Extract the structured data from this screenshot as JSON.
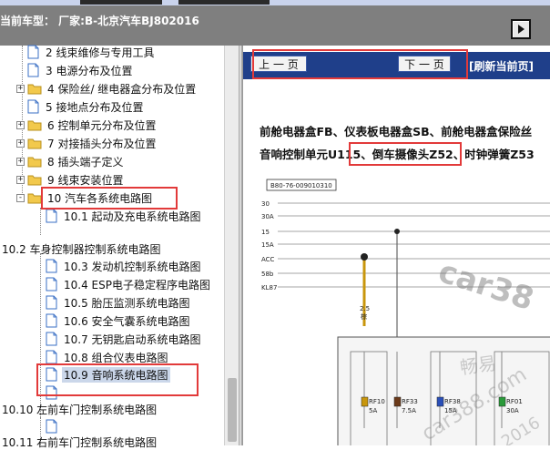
{
  "header": {
    "title": "当前车型：  厂家:B-北京汽车BJ802016"
  },
  "tree": {
    "items": [
      {
        "label": "2 线束维修与专用工具"
      },
      {
        "label": "3 电源分布及位置"
      },
      {
        "label": "4 保险丝/ 继电器盒分布及位置"
      },
      {
        "label": "5 接地点分布及位置"
      },
      {
        "label": "6 控制单元分布及位置"
      },
      {
        "label": "7 对接插头分布及位置"
      },
      {
        "label": "8 插头端子定义"
      },
      {
        "label": "9 线束安装位置"
      },
      {
        "label": "10 汽车各系统电路图"
      },
      {
        "label": "10.1 起动及充电系统电路图"
      },
      {
        "label": "10.2 车身控制器控制系统电路图"
      },
      {
        "label": "10.3 发动机控制系统电路图"
      },
      {
        "label": "10.4 ESP电子稳定程序电路图"
      },
      {
        "label": "10.5 胎压监测系统电路图"
      },
      {
        "label": "10.6 安全气囊系统电路图"
      },
      {
        "label": "10.7 无钥匙启动系统电路图"
      },
      {
        "label": "10.8 组合仪表电路图"
      },
      {
        "label": "10.9 音响系统电路图"
      },
      {
        "label": "10.10 左前车门控制系统电路图"
      },
      {
        "label": "10.11 右前车门控制系统电路图"
      }
    ]
  },
  "doc": {
    "prev_label": "上 一 页",
    "next_label": "下 一 页",
    "refresh_label": "[刷新当前页]",
    "line1": "前舱电器盒FB、仪表板电器盒SB、前舱电器盒保险丝",
    "line2_a": "音响控制单元U115、",
    "line2_b": "倒车摄像头Z52",
    "line2_c": "、时钟弹簧Z53",
    "diagram_id": "B80-76-009010310",
    "rails": [
      "30",
      "30A",
      "15",
      "15A",
      "ACC",
      "58b",
      "KL87"
    ],
    "wire_label_a": "2.5",
    "wire_label_b": "棕",
    "fuses": [
      {
        "name": "RF10",
        "rating": "5A"
      },
      {
        "name": "RF33",
        "rating": "7.5A"
      },
      {
        "name": "RF38",
        "rating": "15A"
      },
      {
        "name": "RF01",
        "rating": "30A"
      }
    ],
    "watermark_1": "car38",
    "watermark_2": "畅易",
    "watermark_3": "car388.com",
    "watermark_4": "2016"
  },
  "colors": {
    "header_bg": "#7f7f7f",
    "doc_bar_bg": "#1f3f8a",
    "highlight_red": "#e23a3a",
    "selection_bg": "#cbd7ea"
  }
}
